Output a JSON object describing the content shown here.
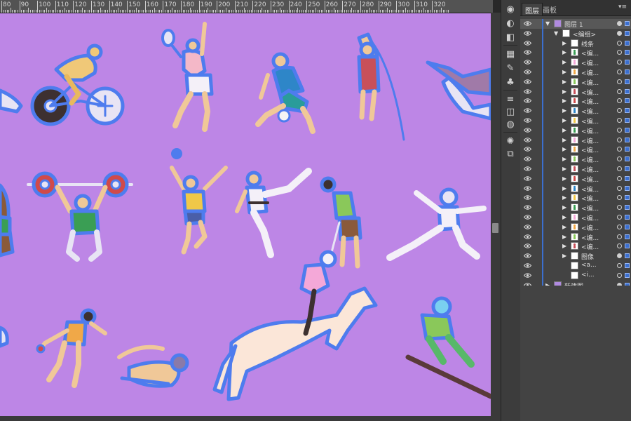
{
  "ruler": {
    "labels": [
      "80",
      "90",
      "100",
      "110",
      "120",
      "130",
      "140",
      "150",
      "160",
      "170",
      "180",
      "190",
      "200",
      "210",
      "220",
      "230",
      "240",
      "250",
      "260",
      "270",
      "280",
      "290",
      "300",
      "310",
      "320"
    ]
  },
  "colors": {
    "artboard_bg": "#bd86e6",
    "outline": "#4e7cee",
    "panel_bg": "#434343",
    "selection_blue": "#3b6fcf"
  },
  "panel": {
    "tabs": [
      "图层",
      "画板"
    ],
    "menu_icon": "menu-icon"
  },
  "layers": [
    {
      "label": "图层 1",
      "level": 0,
      "expanded": true,
      "thumb": "purple"
    },
    {
      "label": "<编组>",
      "level": 1,
      "expanded": true,
      "thumb": "white"
    },
    {
      "label": "线条",
      "level": 2,
      "expanded": false,
      "thumb": "white"
    },
    {
      "label": "<编...",
      "level": 2,
      "expanded": false,
      "thumb": "figure"
    },
    {
      "label": "<编...",
      "level": 2,
      "expanded": false,
      "thumb": "figure"
    },
    {
      "label": "<编...",
      "level": 2,
      "expanded": false,
      "thumb": "figure"
    },
    {
      "label": "<编...",
      "level": 2,
      "expanded": false,
      "thumb": "figure"
    },
    {
      "label": "<编...",
      "level": 2,
      "expanded": false,
      "thumb": "figure"
    },
    {
      "label": "<编...",
      "level": 2,
      "expanded": false,
      "thumb": "figure"
    },
    {
      "label": "<编...",
      "level": 2,
      "expanded": false,
      "thumb": "figure"
    },
    {
      "label": "<编...",
      "level": 2,
      "expanded": false,
      "thumb": "figure"
    },
    {
      "label": "<编...",
      "level": 2,
      "expanded": false,
      "thumb": "figure"
    },
    {
      "label": "<编...",
      "level": 2,
      "expanded": false,
      "thumb": "figure"
    },
    {
      "label": "<编...",
      "level": 2,
      "expanded": false,
      "thumb": "figure"
    },
    {
      "label": "<编...",
      "level": 2,
      "expanded": false,
      "thumb": "figure"
    },
    {
      "label": "<编...",
      "level": 2,
      "expanded": false,
      "thumb": "figure"
    },
    {
      "label": "<编...",
      "level": 2,
      "expanded": false,
      "thumb": "figure"
    },
    {
      "label": "<编...",
      "level": 2,
      "expanded": false,
      "thumb": "figure"
    },
    {
      "label": "<编...",
      "level": 2,
      "expanded": false,
      "thumb": "figure"
    },
    {
      "label": "<编...",
      "level": 2,
      "expanded": false,
      "thumb": "figure"
    },
    {
      "label": "<编...",
      "level": 2,
      "expanded": false,
      "thumb": "figure"
    },
    {
      "label": "<编...",
      "level": 2,
      "expanded": false,
      "thumb": "figure"
    },
    {
      "label": "<编...",
      "level": 2,
      "expanded": false,
      "thumb": "figure"
    },
    {
      "label": "<编...",
      "level": 2,
      "expanded": false,
      "thumb": "figure"
    },
    {
      "label": "图像",
      "level": 2,
      "expanded": false,
      "thumb": "white"
    },
    {
      "label": "<a...",
      "level": 2,
      "expanded": null,
      "thumb": "white"
    },
    {
      "label": "<i...",
      "level": 2,
      "expanded": null,
      "thumb": "white"
    },
    {
      "label": "新建图...",
      "level": 0,
      "expanded": false,
      "thumb": "purple"
    }
  ],
  "tools": [
    "color-icon",
    "stroke-icon",
    "pathfinder-icon",
    "swatches-icon",
    "brushes-icon",
    "symbols-icon",
    "align-icon",
    "transparency-icon",
    "appearance-icon",
    "graphic-styles-icon",
    "links-icon"
  ]
}
